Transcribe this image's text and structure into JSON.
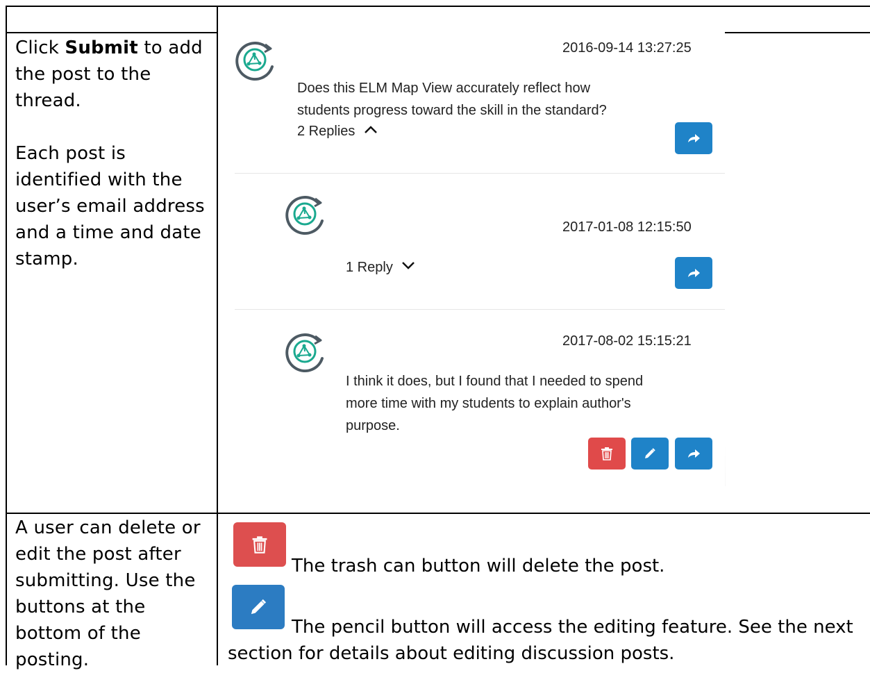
{
  "row1": {
    "instruction_pre": "Click ",
    "instruction_bold": "Submit",
    "instruction_post": " to add the post to the thread.",
    "description": "Each post is identified with the user’s email address and a time and date stamp."
  },
  "screenshot": {
    "posts": [
      {
        "timestamp": "2016-09-14 13:27:25",
        "body_line1": "Does this ELM Map View accurately reflect how",
        "body_line2": "students progress toward the skill in the standard?",
        "replies_label": "2 Replies",
        "replies_icon": "chevron-up-icon"
      },
      {
        "timestamp": "2017-01-08 12:15:50",
        "replies_label": "1 Reply",
        "replies_icon": "chevron-down-icon"
      },
      {
        "timestamp": "2017-08-02 15:15:21",
        "body_line1": "I think it does, but I found that I needed to spend",
        "body_line2": "more time with my students to explain author's",
        "body_line3": "purpose."
      }
    ],
    "colors": {
      "blue_button": "#1f83c8",
      "red_button": "#e04a4a",
      "avatar_teal": "#1aa98f",
      "avatar_gray": "#4d5a63"
    }
  },
  "row2": {
    "left_text": "A user can delete or edit the post after submitting. Use the buttons at the bottom of the posting.",
    "trash_text": "The trash can button will delete the post.",
    "pencil_text": "The pencil button will access the editing feature. See the next",
    "pencil_text_cont": "section for details about editing discussion posts."
  }
}
